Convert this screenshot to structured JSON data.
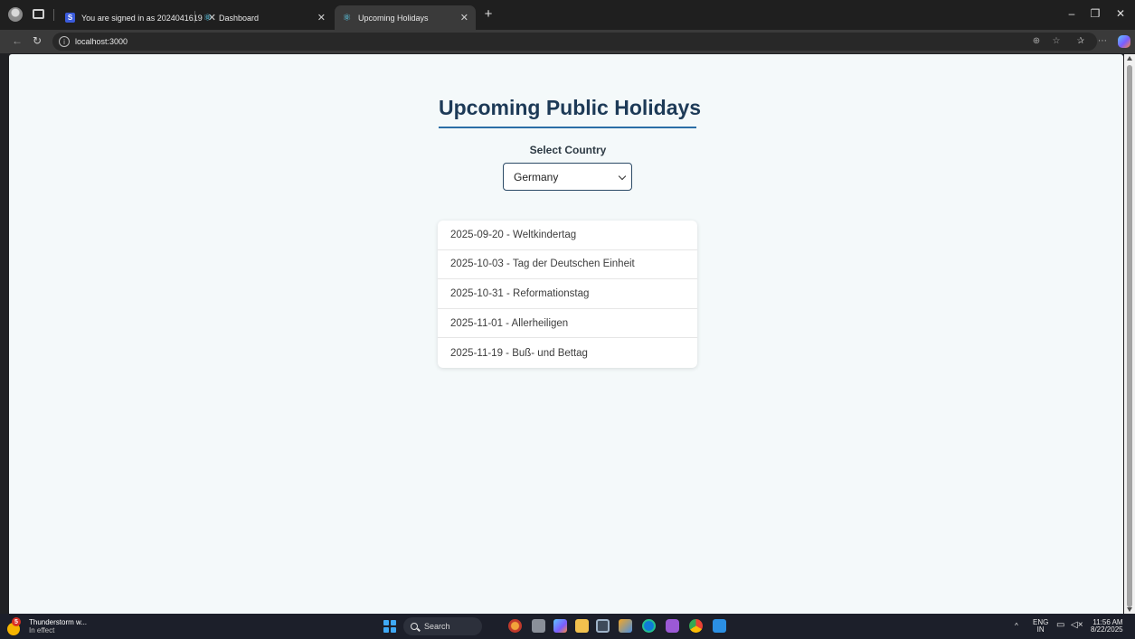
{
  "browser": {
    "tabs": [
      {
        "label": "You are signed in as 2024041619",
        "favicon": "s-badge-icon"
      },
      {
        "label": "Dashboard",
        "favicon": "react-icon"
      },
      {
        "label": "Upcoming Holidays",
        "favicon": "react-icon",
        "active": true
      }
    ],
    "url": "localhost:3000"
  },
  "page": {
    "title": "Upcoming Public Holidays",
    "select_label": "Select Country",
    "selected_country": "Germany",
    "holidays": [
      {
        "text": "2025-09-20 - Weltkindertag"
      },
      {
        "text": "2025-10-03 - Tag der Deutschen Einheit"
      },
      {
        "text": "2025-10-31 - Reformationstag"
      },
      {
        "text": "2025-11-01 - Allerheiligen"
      },
      {
        "text": "2025-11-19 - Buß- und Bettag"
      }
    ],
    "colors": {
      "title": "#1d3a57",
      "underline": "#2b6ea6",
      "background": "#f4f9fa"
    }
  },
  "taskbar": {
    "weather_title": "Thunderstorm w...",
    "weather_sub": "In effect",
    "weather_badge": "5",
    "search_label": "Search",
    "lang_top": "ENG",
    "lang_bottom": "IN",
    "time": "11:56 AM",
    "date": "8/22/2025"
  }
}
